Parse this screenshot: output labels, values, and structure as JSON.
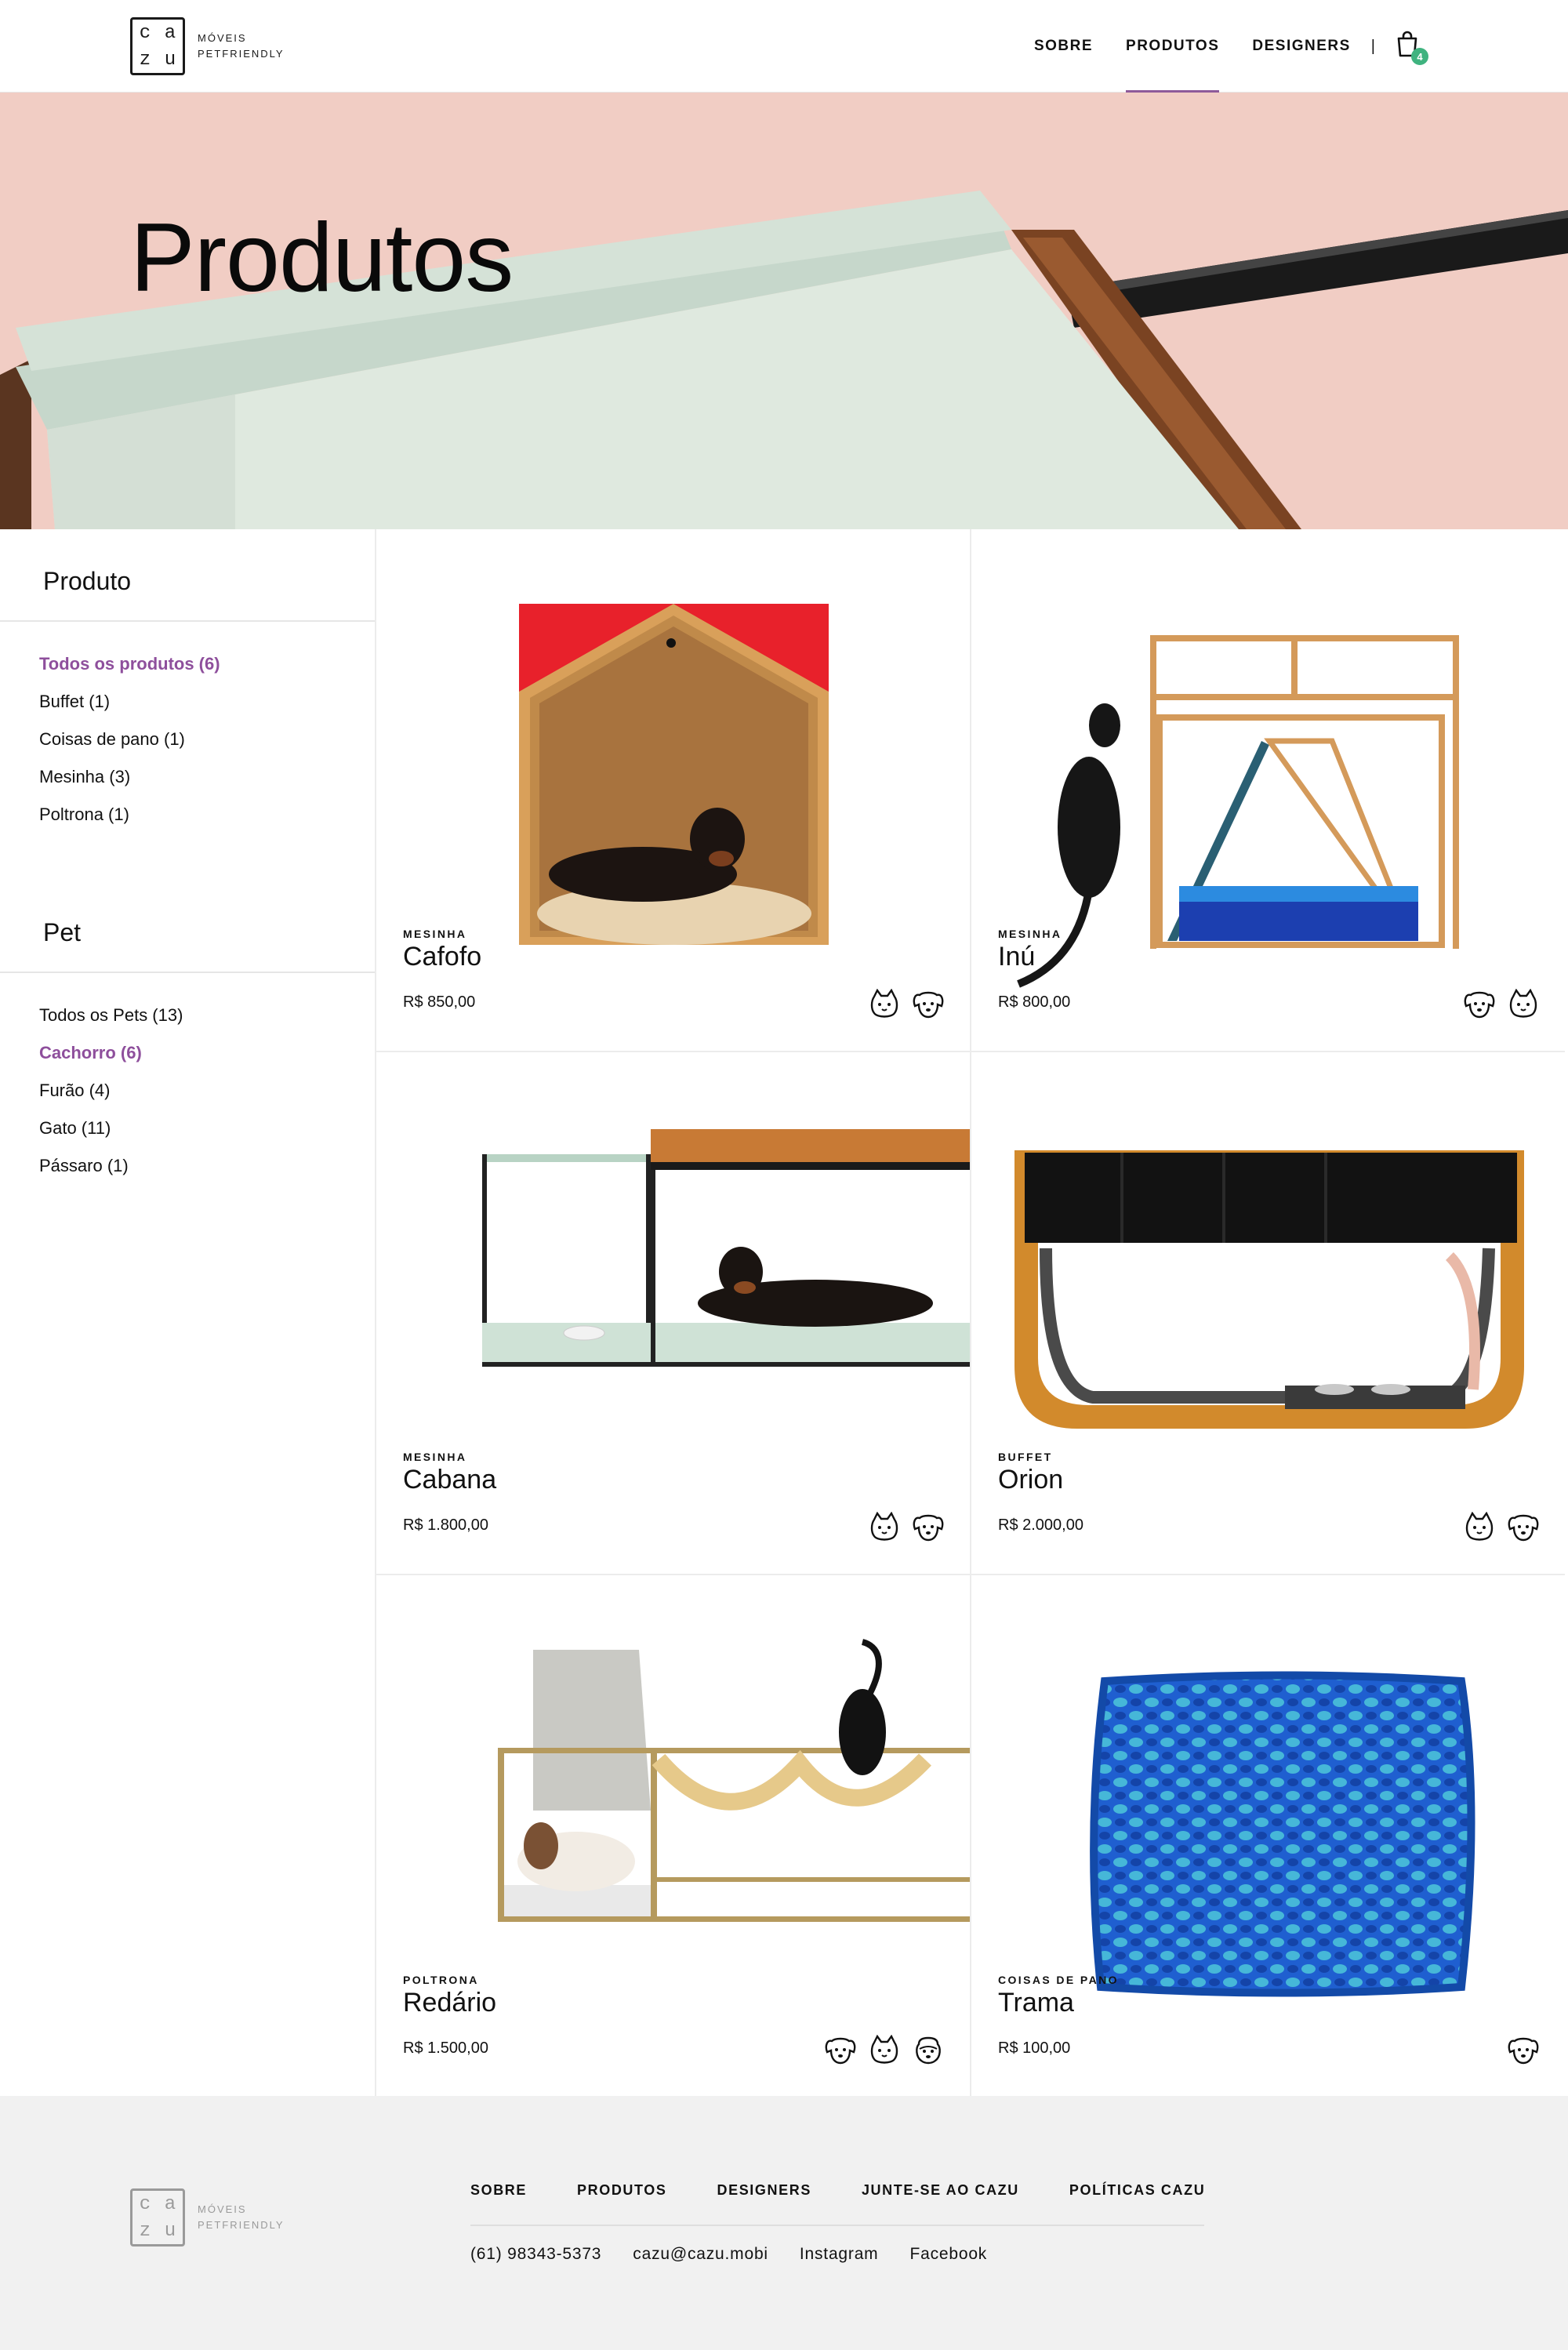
{
  "brand": {
    "logo_letters": [
      "c",
      "a",
      "z",
      "u"
    ],
    "line1": "MÓVEIS",
    "line2": "PETFRIENDLY"
  },
  "nav": {
    "items": [
      "SOBRE",
      "PRODUTOS",
      "DESIGNERS"
    ],
    "active": "PRODUTOS",
    "separator": "|",
    "cart_count": "4"
  },
  "hero": {
    "title": "Produtos"
  },
  "filters": {
    "produto": {
      "title": "Produto",
      "items": [
        "Todos os produtos (6)",
        "Buffet (1)",
        "Coisas de pano (1)",
        "Mesinha (3)",
        "Poltrona (1)"
      ],
      "active_index": 0
    },
    "pet": {
      "title": "Pet",
      "items": [
        "Todos os Pets (13)",
        "Cachorro (6)",
        "Furão (4)",
        "Gato (11)",
        "Pássaro (1)"
      ],
      "active_index": 1
    }
  },
  "products": [
    {
      "category": "MESINHA",
      "name": "Cafofo",
      "price": "R$ 850,00",
      "pets": [
        "cat-icon",
        "dog-icon"
      ]
    },
    {
      "category": "MESINHA",
      "name": "Inú",
      "price": "R$ 800,00",
      "pets": [
        "dog-icon",
        "cat-icon"
      ]
    },
    {
      "category": "MESINHA",
      "name": "Cabana",
      "price": "R$ 1.800,00",
      "pets": [
        "cat-icon",
        "dog-icon"
      ]
    },
    {
      "category": "BUFFET",
      "name": "Orion",
      "price": "R$ 2.000,00",
      "pets": [
        "cat-icon",
        "dog-icon"
      ]
    },
    {
      "category": "POLTRONA",
      "name": "Redário",
      "price": "R$ 1.500,00",
      "pets": [
        "dog-icon",
        "cat-icon",
        "ferret-icon"
      ]
    },
    {
      "category": "COISAS DE PANO",
      "name": "Trama",
      "price": "R$ 100,00",
      "pets": [
        "dog-icon"
      ]
    }
  ],
  "footer": {
    "nav": [
      "SOBRE",
      "PRODUTOS",
      "DESIGNERS",
      "JUNTE-SE AO CAZU",
      "POLÍTICAS CAZU"
    ],
    "phone": "(61) 98343-5373",
    "email": "cazu@cazu.mobi",
    "instagram": "Instagram",
    "facebook": "Facebook"
  },
  "colors": {
    "accent": "#8e4f9c",
    "hero_bg": "#f1cdc4",
    "badge": "#3fb37f",
    "footer_bg": "#f1f1f1"
  }
}
